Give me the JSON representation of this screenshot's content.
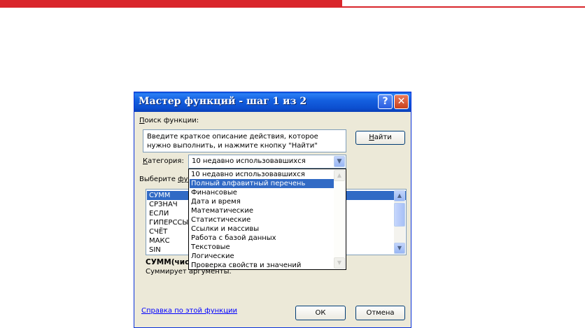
{
  "colors": {
    "accent_red": "#d9262b",
    "title_blue": "#0c4fd0",
    "selection": "#316ac5",
    "link": "#0000ff"
  },
  "window": {
    "title": "Мастер функций - шаг 1 из 2",
    "help_label": "?",
    "close_label": "✕"
  },
  "search": {
    "label_key": "П",
    "label_rest": "оиск функции:",
    "placeholder": "Введите краткое описание действия, которое нужно выполнить, и нажмите кнопку \"Найти\"",
    "find_key": "Н",
    "find_rest": "айти"
  },
  "category": {
    "label_key": "К",
    "label_rest": "атегория:",
    "selected": "10 недавно использовавшихся",
    "options": [
      "10 недавно использовавшихся",
      "Полный алфавитный перечень",
      "Финансовые",
      "Дата и время",
      "Математические",
      "Статистические",
      "Ссылки и массивы",
      "Работа с базой данных",
      "Текстовые",
      "Логические",
      "Проверка свойств и значений"
    ],
    "highlighted_index": 1
  },
  "functions": {
    "label_start": "Выберите ",
    "label_key": "фу",
    "items": [
      "СУММ",
      "СРЗНАЧ",
      "ЕСЛИ",
      "ГИПЕРССЫЛ",
      "СЧЁТ",
      "МАКС",
      "SIN"
    ],
    "selected_index": 0
  },
  "signature": "СУММ(числ",
  "description": "Суммирует аргументы.",
  "footer": {
    "help_link": "Справка по этой функции",
    "ok_label": "ОК",
    "cancel_label": "Отмена"
  },
  "icons": {
    "dropdown_arrow": "chevron-down-icon",
    "scroll_up": "scroll-up-icon",
    "scroll_down": "scroll-down-icon"
  }
}
